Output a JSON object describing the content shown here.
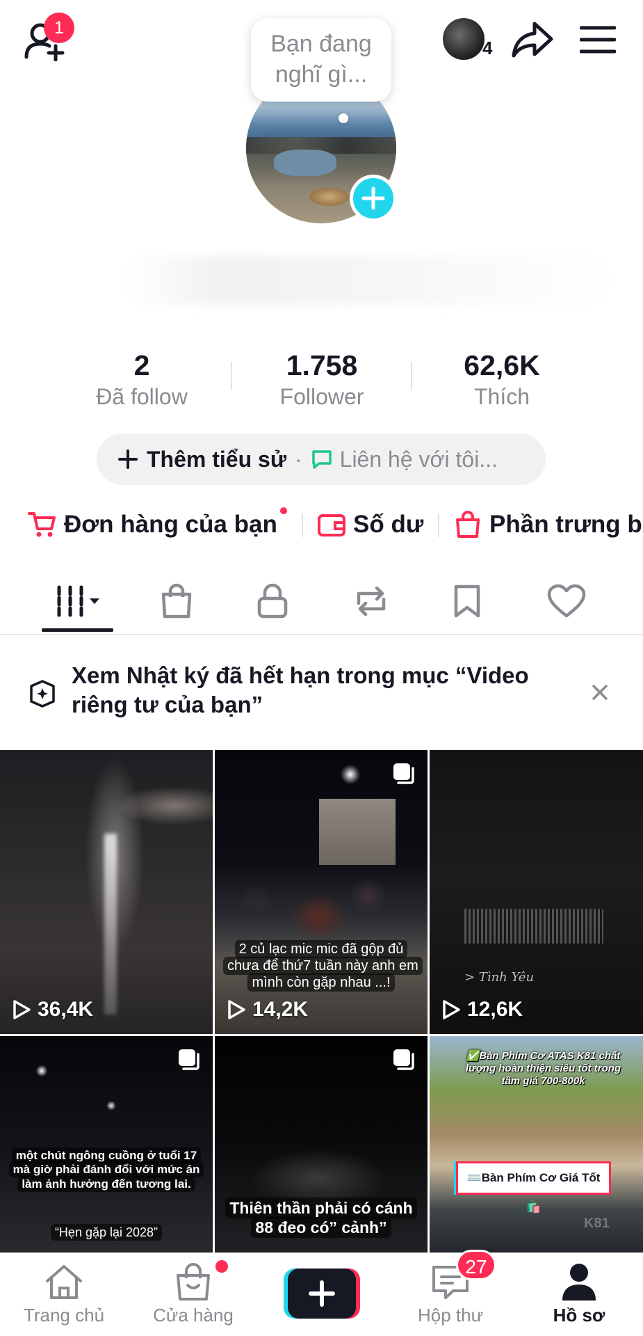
{
  "header": {
    "friend_badge": "1",
    "story_count": "4",
    "thought_bubble": "Bạn đang nghĩ gì..."
  },
  "stats": [
    {
      "value": "2",
      "label": "Đã follow"
    },
    {
      "value": "1.758",
      "label": "Follower"
    },
    {
      "value": "62,6K",
      "label": "Thích"
    }
  ],
  "bio": {
    "add_bio_label": "Thêm tiểu sử",
    "separator": "·",
    "contact_label": "Liên hệ với tôi..."
  },
  "shop_row": {
    "orders_label": "Đơn hàng của bạn",
    "balance_label": "Số dư",
    "showcase_label": "Phần trưng b"
  },
  "tabs": [
    "videos",
    "shop",
    "private",
    "reposts",
    "saved",
    "liked"
  ],
  "banner": {
    "text": "Xem Nhật ký đã hết hạn trong mục “Video riêng tư của bạn”"
  },
  "videos": [
    {
      "views": "36,4K",
      "caption": ""
    },
    {
      "views": "14,2K",
      "caption": "2 củ lạc mic mic đã gộp đủ chưa để thứ7 tuần này anh em mình còn gặp nhau ...!"
    },
    {
      "views": "12,6K",
      "caption": "",
      "overlay_text": "> Tình Yêu"
    },
    {
      "views": "",
      "caption": "một chút ngông cuồng ở tuổi 17 mà giờ phải đánh đổi với mức án làm ảnh hưởng đến tương lai.",
      "caption2": "“Hẹn gặp lại 2028”"
    },
    {
      "views": "",
      "caption": "Thiên thần phải có cánh 88 đeo có” cảnh”"
    },
    {
      "views": "",
      "caption": "✅Bàn Phím Cơ ATAS K81 chất lượng hoàn thiện siêu tốt trong tầm giá 700-800k",
      "banner": "⌨️Bàn Phím Cơ Giá Tốt 🛍️",
      "brand": "K81"
    }
  ],
  "bottom_nav": {
    "home": "Trang chủ",
    "shop": "Cửa hàng",
    "inbox": "Hộp thư",
    "inbox_badge": "27",
    "profile": "Hồ sơ"
  },
  "colors": {
    "accent": "#fe2c55",
    "cyan": "#20d5ec",
    "muted_text": "#8a8b91",
    "primary_text": "#161823"
  }
}
